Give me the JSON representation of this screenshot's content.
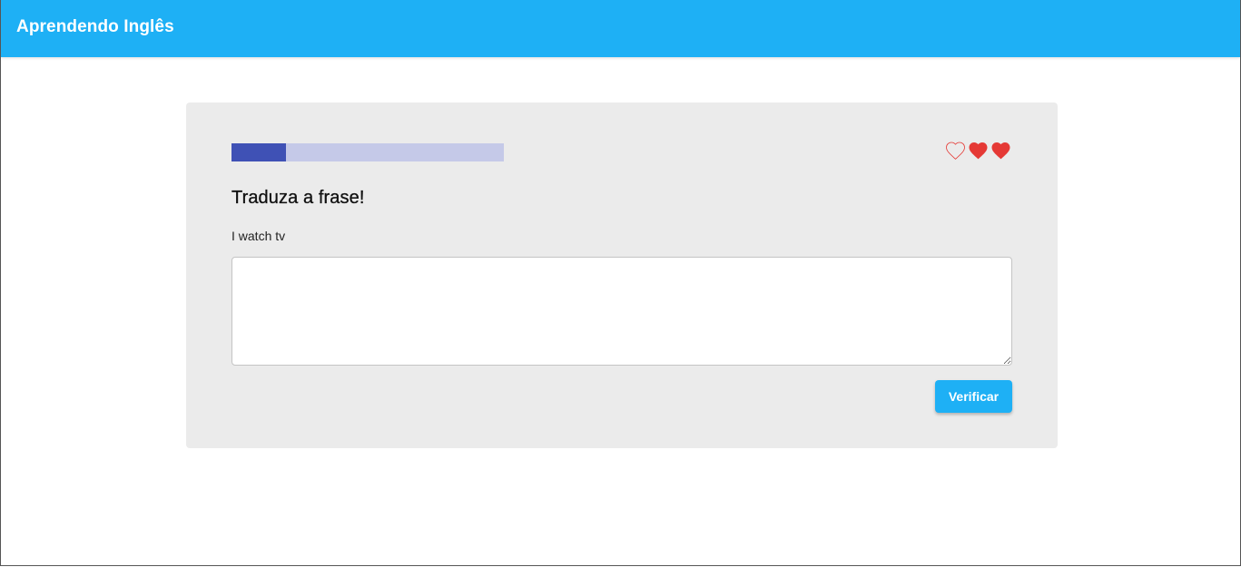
{
  "app": {
    "title": "Aprendendo Inglês"
  },
  "colors": {
    "app_bar": "#1eb0f5",
    "progress_fill": "#3f51b5",
    "progress_track": "#c5c9e8",
    "heart": "#e53935",
    "card_background": "#ebebeb",
    "button": "#1eb0f5"
  },
  "lesson": {
    "progress_fraction": 0.2,
    "lives": [
      {
        "icon": "heart-outline-icon",
        "filled": false
      },
      {
        "icon": "heart-icon",
        "filled": true
      },
      {
        "icon": "heart-icon",
        "filled": true
      }
    ],
    "instruction": "Traduza a frase!",
    "phrase": "I watch tv",
    "answer_value": "",
    "answer_placeholder": "",
    "verify_label": "Verificar"
  }
}
